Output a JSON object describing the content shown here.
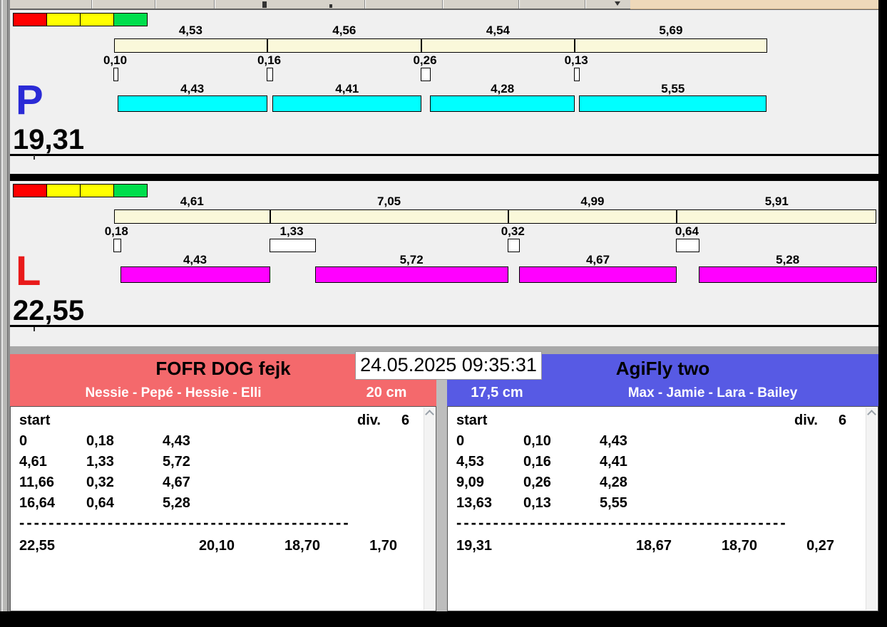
{
  "window": {
    "datetime": "24.05.2025 09:35:31"
  },
  "traffic_lights": [
    "#FF0000",
    "#FFFF00",
    "#FFFF00",
    "#00DE4C"
  ],
  "lanes": [
    {
      "letter": "P",
      "letter_color": "#2B2BD6",
      "bar_color": "#00FFFF",
      "total": "19,31",
      "splits": [
        "4,53",
        "4,56",
        "4,54",
        "5,69"
      ],
      "passes": [
        "0,10",
        "0,16",
        "0,26",
        "0,13"
      ],
      "dogs": [
        "4,43",
        "4,41",
        "4,28",
        "5,55"
      ]
    },
    {
      "letter": "L",
      "letter_color": "#E91A1A",
      "bar_color": "#FF00FF",
      "total": "22,55",
      "splits": [
        "4,61",
        "7,05",
        "4,99",
        "5,91"
      ],
      "passes": [
        "0,18",
        "1,33",
        "0,32",
        "0,64"
      ],
      "dogs": [
        "4,43",
        "5,72",
        "4,67",
        "5,28"
      ]
    }
  ],
  "teams": [
    {
      "name": "FOFR DOG fejk",
      "dogs": "Nessie - Pepé - Hessie - Elli",
      "height": "20 cm",
      "color": "#F4696C",
      "table": {
        "start_label": "start",
        "div_label": "div.",
        "div_value": "6",
        "rows": [
          [
            "0",
            "0,18",
            "4,43"
          ],
          [
            "4,61",
            "1,33",
            "5,72"
          ],
          [
            "11,66",
            "0,32",
            "4,67"
          ],
          [
            "16,64",
            "0,64",
            "5,28"
          ]
        ],
        "separator": "---------------------------------------------",
        "totals": [
          "22,55",
          "20,10",
          "18,70",
          "1,70"
        ]
      }
    },
    {
      "name": "AgiFly two",
      "dogs": "Max - Jamie - Lara - Bailey",
      "height": "17,5 cm",
      "color": "#575AE4",
      "table": {
        "start_label": "start",
        "div_label": "div.",
        "div_value": "6",
        "rows": [
          [
            "0",
            "0,10",
            "4,43"
          ],
          [
            "4,53",
            "0,16",
            "4,41"
          ],
          [
            "9,09",
            "0,26",
            "4,28"
          ],
          [
            "13,63",
            "0,13",
            "5,55"
          ]
        ],
        "separator": "---------------------------------------------",
        "totals": [
          "19,31",
          "18,67",
          "18,70",
          "0,27"
        ]
      }
    }
  ]
}
